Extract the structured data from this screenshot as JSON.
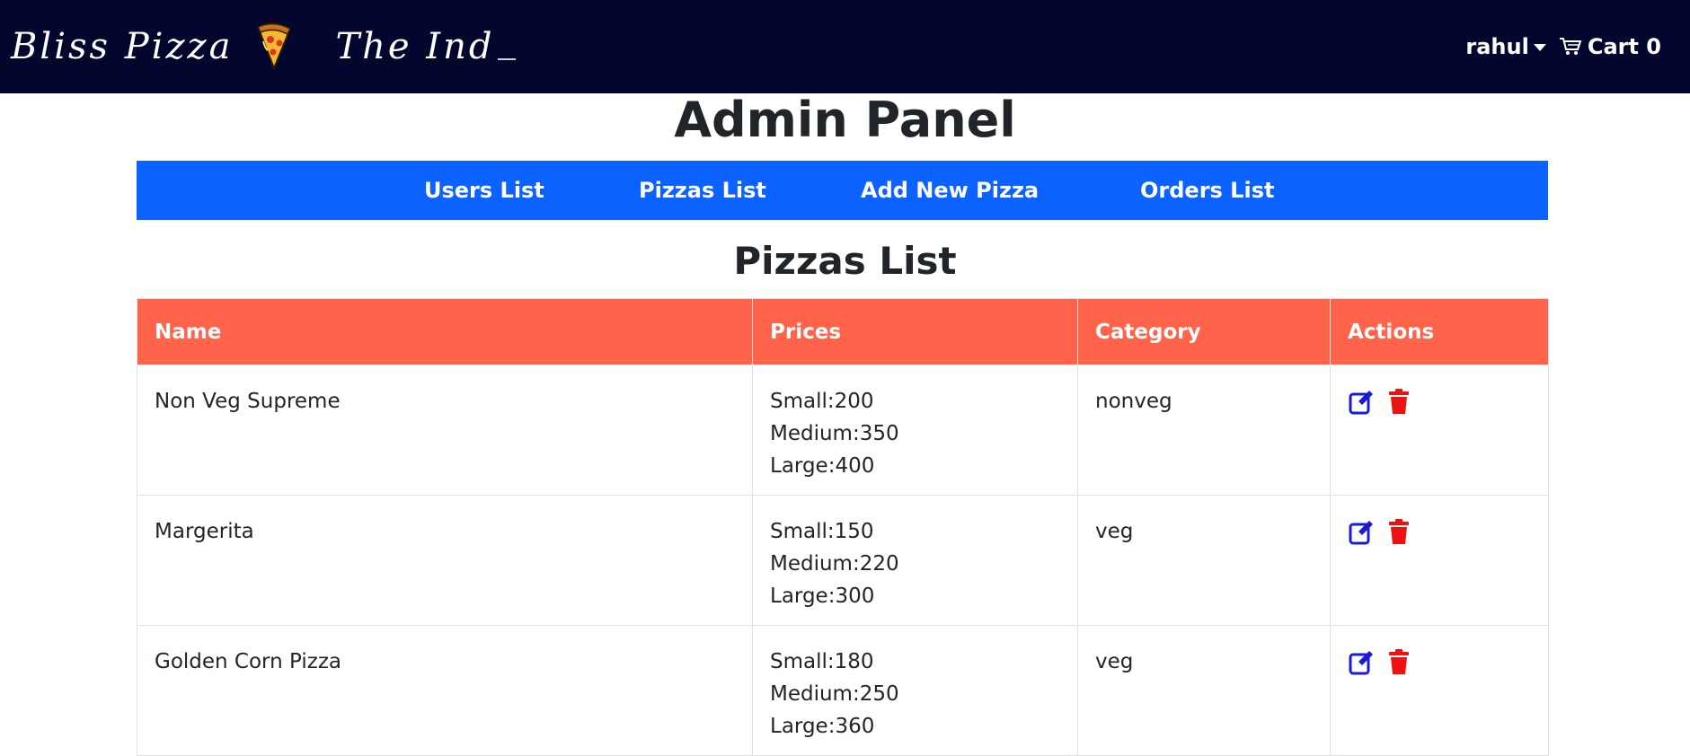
{
  "navbar": {
    "brand_name": "Bliss Pizza",
    "brand_typing": "The Ind",
    "user_label": "rahul",
    "cart_label": "Cart 0",
    "colors": {
      "background": "#03062d",
      "text": "#ffffff"
    }
  },
  "page": {
    "title": "Admin Panel"
  },
  "admin_nav": {
    "items": [
      {
        "label": "Users List"
      },
      {
        "label": "Pizzas List"
      },
      {
        "label": "Add New Pizza"
      },
      {
        "label": "Orders List"
      }
    ],
    "color": "#0b62ff"
  },
  "pizzas": {
    "section_title": "Pizzas List",
    "header_color": "#ff634a",
    "columns": [
      "Name",
      "Prices",
      "Category",
      "Actions"
    ],
    "rows": [
      {
        "name": "Non Veg Supreme",
        "prices": [
          "Small:200",
          "Medium:350",
          "Large:400"
        ],
        "category": "nonveg",
        "actions": [
          "edit-icon",
          "delete-icon"
        ]
      },
      {
        "name": "Margerita",
        "prices": [
          "Small:150",
          "Medium:220",
          "Large:300"
        ],
        "category": "veg",
        "actions": [
          "edit-icon",
          "delete-icon"
        ]
      },
      {
        "name": "Golden Corn Pizza",
        "prices": [
          "Small:180",
          "Medium:250",
          "Large:360"
        ],
        "category": "veg",
        "actions": [
          "edit-icon",
          "delete-icon"
        ]
      }
    ]
  },
  "icon_colors": {
    "edit": "#1a1ad6",
    "delete": "#ee1111"
  }
}
